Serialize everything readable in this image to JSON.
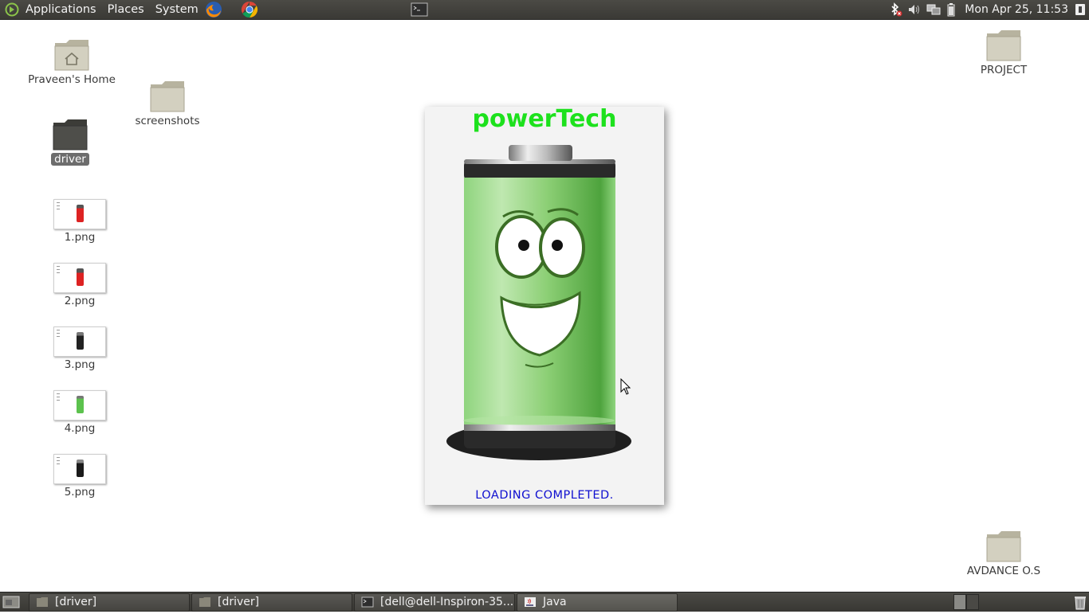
{
  "top_panel": {
    "menus": [
      "Applications",
      "Places",
      "System"
    ],
    "clock": "Mon Apr 25, 11:53",
    "launchers": [
      "firefox-icon",
      "chrome-icon"
    ],
    "tray_icons": [
      "bluetooth-disabled-icon",
      "volume-icon",
      "network-icon",
      "battery-icon"
    ]
  },
  "desktop": {
    "icons": [
      {
        "label": "Praveen's Home",
        "icon": "home-folder-icon"
      },
      {
        "label": "screenshots",
        "icon": "folder-icon"
      },
      {
        "label": "driver",
        "icon": "folder-icon",
        "selected": true
      },
      {
        "label": "1.png",
        "icon": "image-file-icon"
      },
      {
        "label": "2.png",
        "icon": "image-file-icon"
      },
      {
        "label": "3.png",
        "icon": "image-file-icon"
      },
      {
        "label": "4.png",
        "icon": "image-file-icon"
      },
      {
        "label": "5.png",
        "icon": "image-file-icon"
      },
      {
        "label": "PROJECT",
        "icon": "folder-icon"
      },
      {
        "label": "AVDANCE O.S",
        "icon": "folder-icon"
      }
    ]
  },
  "splash": {
    "title": "powerTech",
    "status": "LOADING COMPLETED.",
    "colors": {
      "title": "#1de11d",
      "status": "#1010d0",
      "battery": "#7fd36a"
    }
  },
  "taskbar": {
    "tasks": [
      {
        "label": "[driver]",
        "icon": "folder-icon"
      },
      {
        "label": "[driver]",
        "icon": "folder-icon"
      },
      {
        "label": "[dell@dell-Inspiron-35...",
        "icon": "terminal-icon"
      },
      {
        "label": "Java",
        "icon": "java-icon"
      }
    ]
  }
}
